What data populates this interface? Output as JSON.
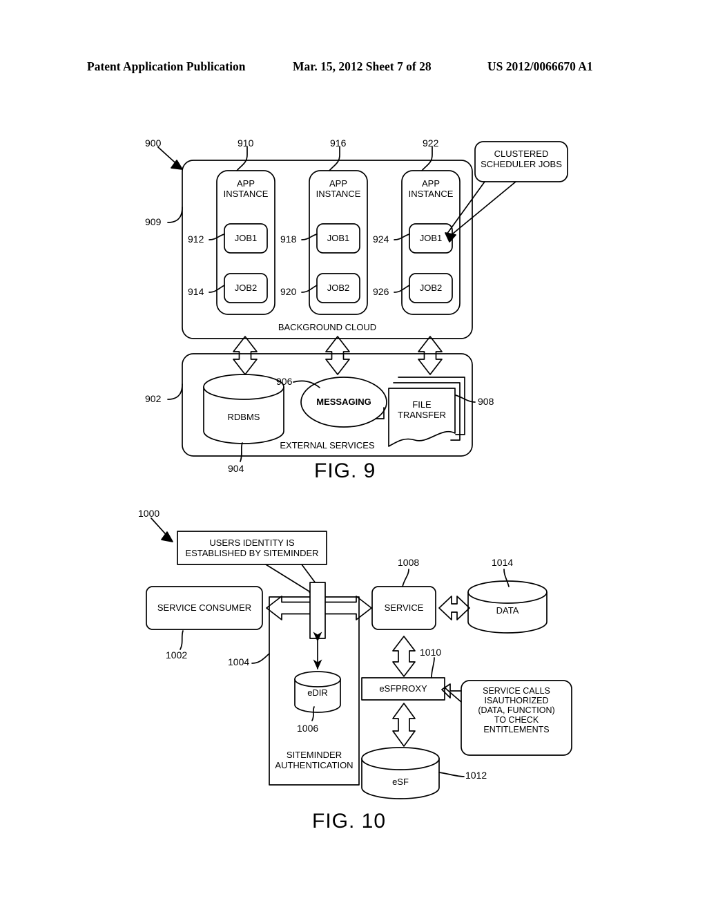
{
  "header": {
    "left": "Patent Application Publication",
    "middle": "Mar. 15, 2012  Sheet 7 of 28",
    "right": "US 2012/0066670 A1"
  },
  "figures": [
    {
      "id": "fig9",
      "caption": "FIG. 9",
      "ref_root": "900",
      "nodes": {
        "background_cloud": {
          "label": "BACKGROUND CLOUD",
          "ref": "909"
        },
        "external_services": {
          "label": "EXTERNAL SERVICES",
          "ref": "902"
        },
        "app_instance_1": {
          "label": "APP\nINSTANCE",
          "ref": "910"
        },
        "app_instance_2": {
          "label": "APP\nINSTANCE",
          "ref": "916"
        },
        "app_instance_3": {
          "label": "APP\nINSTANCE",
          "ref": "922"
        },
        "job1_a": {
          "label": "JOB1",
          "ref": "912"
        },
        "job2_a": {
          "label": "JOB2",
          "ref": "914"
        },
        "job1_b": {
          "label": "JOB1",
          "ref": "918"
        },
        "job2_b": {
          "label": "JOB2",
          "ref": "920"
        },
        "job1_c": {
          "label": "JOB1",
          "ref": "924"
        },
        "job2_c": {
          "label": "JOB2",
          "ref": "926"
        },
        "rdbms": {
          "label": "RDBMS",
          "ref": "904"
        },
        "messaging": {
          "label": "MESSAGING",
          "ref": "906"
        },
        "file_transfer": {
          "label": "FILE\nTRANSFER",
          "ref": "908"
        },
        "callout": {
          "label": "CLUSTERED\nSCHEDULER JOBS"
        }
      }
    },
    {
      "id": "fig10",
      "caption": "FIG. 10",
      "ref_root": "1000",
      "nodes": {
        "callout_identity": {
          "label": "USERS IDENTITY IS\nESTABLISHED BY SITEMINDER"
        },
        "service_consumer": {
          "label": "SERVICE CONSUMER",
          "ref": "1002"
        },
        "siteminder_auth": {
          "label": "SITEMINDER\nAUTHENTICATION",
          "ref": "1004"
        },
        "edir": {
          "label": "eDIR",
          "ref": "1006"
        },
        "service": {
          "label": "SERVICE",
          "ref": "1008"
        },
        "data": {
          "label": "DATA",
          "ref": "1014"
        },
        "esfproxy": {
          "label": "eSFPROXY",
          "ref": "1010"
        },
        "esf": {
          "label": "eSF",
          "ref": "1012"
        },
        "callout_entitlements": {
          "label": "SERVICE CALLS\nISAUTHORIZED\n(DATA, FUNCTION)\nTO CHECK\nENTITLEMENTS"
        }
      }
    }
  ],
  "colors": {
    "ink": "#000000",
    "paper": "#ffffff"
  }
}
